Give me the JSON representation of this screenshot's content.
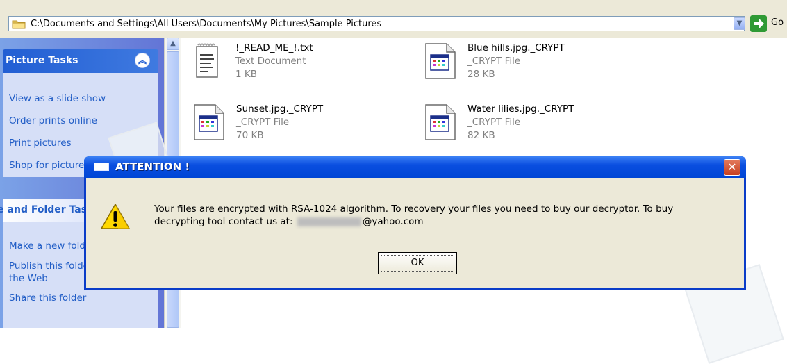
{
  "address_bar": {
    "path": "C:\\Documents and Settings\\All Users\\Documents\\My Pictures\\Sample Pictures",
    "go_label": "Go"
  },
  "sidebar": {
    "picture_tasks": {
      "title": "Picture Tasks",
      "items": [
        "View as a slide show",
        "Order prints online",
        "Print pictures",
        "Shop for pictures online"
      ]
    },
    "folder_tasks": {
      "title": "File and Folder Tasks",
      "items": [
        "Make a new folder",
        "Publish this folder to",
        "the Web",
        "Share this folder"
      ]
    }
  },
  "files": [
    {
      "name": "!_READ_ME_!.txt",
      "type": "Text Document",
      "size": "1 KB",
      "icon": "text-document-icon"
    },
    {
      "name": "Blue hills.jpg._CRYPT",
      "type": "_CRYPT File",
      "size": "28 KB",
      "icon": "unknown-file-icon"
    },
    {
      "name": "Sunset.jpg._CRYPT",
      "type": "_CRYPT File",
      "size": "70 KB",
      "icon": "unknown-file-icon"
    },
    {
      "name": "Water lilies.jpg._CRYPT",
      "type": "_CRYPT File",
      "size": "82 KB",
      "icon": "unknown-file-icon"
    }
  ],
  "dialog": {
    "title": "ATTENTION !",
    "message_line1": "Your files are encrypted with RSA-1024 algorithm.  To recovery your files you need to buy our decryptor.  To buy",
    "message_line2_prefix": "decrypting tool contact us at:",
    "message_line2_suffix": "@yahoo.com",
    "ok_label": "OK",
    "icon": "warning-icon"
  },
  "colors": {
    "xp_blue": "#0a4ee0",
    "sidebar_link": "#215dc6",
    "dialog_bg": "#ece9d8"
  }
}
